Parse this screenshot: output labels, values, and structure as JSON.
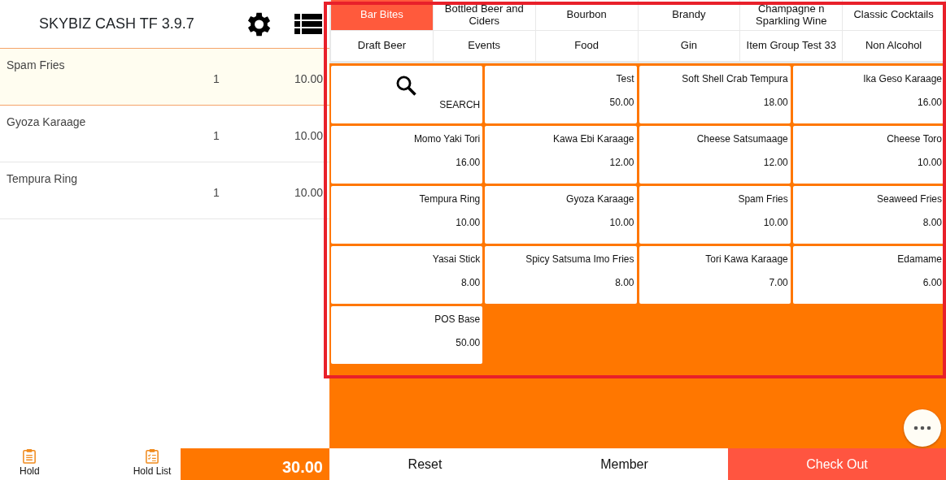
{
  "header": {
    "title": "SKYBIZ CASH TF 3.9.7"
  },
  "order_lines": [
    {
      "name": "Spam Fries",
      "qty": "1",
      "amount": "10.00",
      "selected": true
    },
    {
      "name": "Gyoza Karaage",
      "qty": "1",
      "amount": "10.00",
      "selected": false
    },
    {
      "name": "Tempura Ring",
      "qty": "1",
      "amount": "10.00",
      "selected": false
    }
  ],
  "footer_left": {
    "hold": "Hold",
    "hold_list": "Hold List",
    "total": "30.00"
  },
  "categories": [
    {
      "label": "Bar Bites",
      "selected": true
    },
    {
      "label": "Bottled Beer and Ciders",
      "selected": false
    },
    {
      "label": "Bourbon",
      "selected": false
    },
    {
      "label": "Brandy",
      "selected": false
    },
    {
      "label": "Champagne n Sparkling Wine",
      "selected": false
    },
    {
      "label": "Classic Cocktails",
      "selected": false
    },
    {
      "label": "Draft Beer",
      "selected": false
    },
    {
      "label": "Events",
      "selected": false
    },
    {
      "label": "Food",
      "selected": false
    },
    {
      "label": "Gin",
      "selected": false
    },
    {
      "label": "Item Group Test 33",
      "selected": false
    },
    {
      "label": "Non Alcohol",
      "selected": false
    }
  ],
  "products": [
    {
      "kind": "search",
      "name": "SEARCH"
    },
    {
      "kind": "item",
      "name": "Test",
      "price": "50.00"
    },
    {
      "kind": "item",
      "name": "Soft Shell Crab Tempura",
      "price": "18.00"
    },
    {
      "kind": "item",
      "name": "Ika Geso Karaage",
      "price": "16.00"
    },
    {
      "kind": "item",
      "name": "Momo Yaki Tori",
      "price": "16.00"
    },
    {
      "kind": "item",
      "name": "Kawa Ebi Karaage",
      "price": "12.00"
    },
    {
      "kind": "item",
      "name": "Cheese Satsumaage",
      "price": "12.00"
    },
    {
      "kind": "item",
      "name": "Cheese Toro",
      "price": "10.00"
    },
    {
      "kind": "item",
      "name": "Tempura Ring",
      "price": "10.00"
    },
    {
      "kind": "item",
      "name": "Gyoza Karaage",
      "price": "10.00"
    },
    {
      "kind": "item",
      "name": "Spam Fries",
      "price": "10.00"
    },
    {
      "kind": "item",
      "name": "Seaweed Fries",
      "price": "8.00"
    },
    {
      "kind": "item",
      "name": "Yasai Stick",
      "price": "8.00"
    },
    {
      "kind": "item",
      "name": "Spicy Satsuma Imo Fries",
      "price": "8.00"
    },
    {
      "kind": "item",
      "name": "Tori Kawa Karaage",
      "price": "7.00"
    },
    {
      "kind": "item",
      "name": "Edamame",
      "price": "6.00"
    },
    {
      "kind": "item",
      "name": "POS Base",
      "price": "50.00"
    }
  ],
  "actions": [
    {
      "kind": "plain",
      "label": "Reset"
    },
    {
      "kind": "plain",
      "label": "Member"
    },
    {
      "kind": "primary",
      "label": "Check Out"
    }
  ]
}
